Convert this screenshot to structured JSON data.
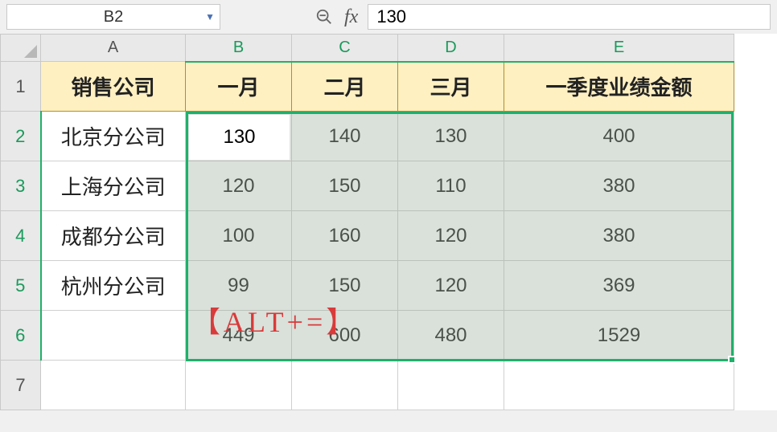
{
  "formula_bar": {
    "name_box": "B2",
    "formula_value": "130"
  },
  "columns": [
    "A",
    "B",
    "C",
    "D",
    "E"
  ],
  "row_numbers": [
    "1",
    "2",
    "3",
    "4",
    "5",
    "6",
    "7"
  ],
  "headers": {
    "A": "销售公司",
    "B": "一月",
    "C": "二月",
    "D": "三月",
    "E": "一季度业绩金额"
  },
  "rows": [
    {
      "label": "北京分公司",
      "b": "130",
      "c": "140",
      "d": "130",
      "e": "400"
    },
    {
      "label": "上海分公司",
      "b": "120",
      "c": "150",
      "d": "110",
      "e": "380"
    },
    {
      "label": "成都分公司",
      "b": "100",
      "c": "160",
      "d": "120",
      "e": "380"
    },
    {
      "label": "杭州分公司",
      "b": "99",
      "c": "150",
      "d": "120",
      "e": "369"
    }
  ],
  "totals": {
    "b": "449",
    "c": "600",
    "d": "480",
    "e": "1529"
  },
  "annotation": "【ALT+=】"
}
